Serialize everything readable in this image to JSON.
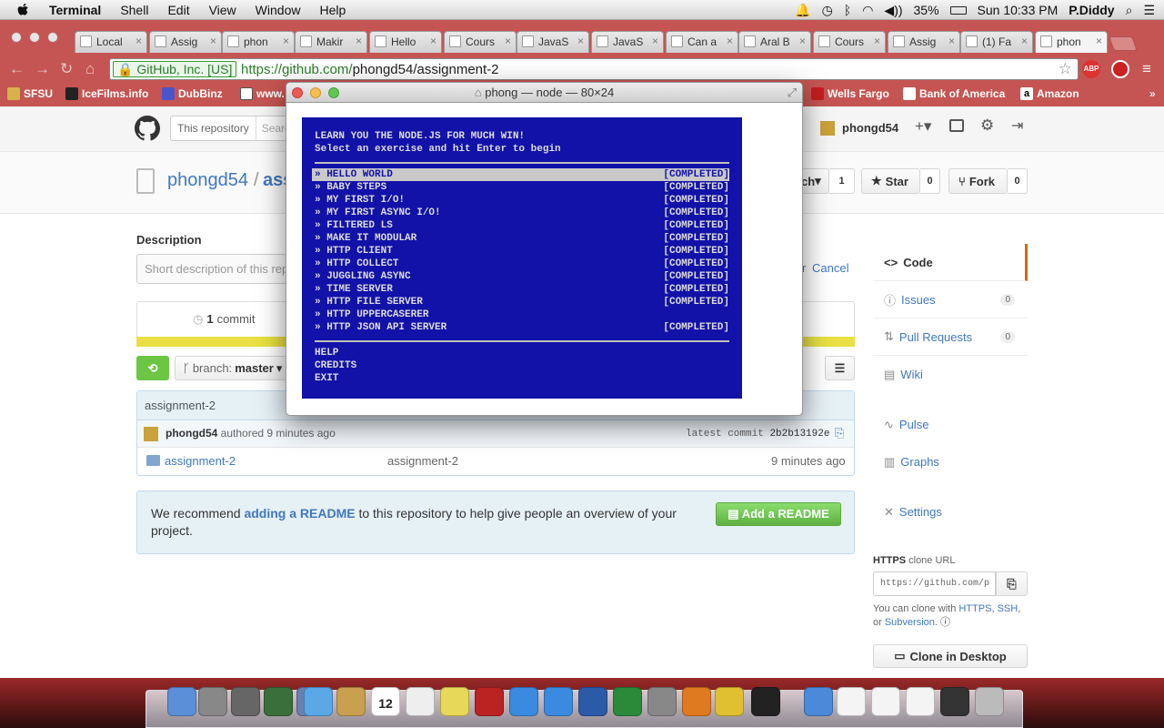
{
  "menubar": {
    "app": "Terminal",
    "items": [
      "Shell",
      "Edit",
      "View",
      "Window",
      "Help"
    ],
    "battery": "35%",
    "clock": "Sun 10:33 PM",
    "user": "P.Diddy"
  },
  "browser": {
    "tabs": [
      "Local",
      "Assig",
      "phon",
      "Makir",
      "Hello",
      "Cours",
      "JavaS",
      "JavaS",
      "Can a",
      "Aral B",
      "Cours",
      "Assig",
      "(1) Fa",
      "phon"
    ],
    "address": {
      "identity": "GitHub, Inc. [US]",
      "url_prefix": "https://github.com/",
      "url_path": "phongd54/assignment-2"
    },
    "bookmarks": [
      "SFSU",
      "IceFilms.info",
      "DubBinz",
      "www.",
      "Wells Fargo",
      "Bank of America",
      "Amazon"
    ],
    "ext": {
      "abp": "ABP"
    }
  },
  "github": {
    "search_scope": "This repository",
    "search_placeholder": "Search",
    "user": "phongd54",
    "owner": "phongd54",
    "repo_partial": "ass",
    "watch_label": "ch",
    "watch_count": "1",
    "star_label": "Star",
    "star_count": "0",
    "fork_label": "Fork",
    "fork_count": "0",
    "description_heading": "Description",
    "description_placeholder": "Short description of this rep",
    "or_text": "r",
    "cancel": "Cancel",
    "commits_count": "1",
    "commits_label": "commit",
    "branch_label": "branch:",
    "branch_name": "master",
    "file_header": "assignment-2",
    "author": "phongd54",
    "authored": "authored 9 minutes ago",
    "latest_commit_label": "latest commit",
    "commit_sha": "2b2b13192e",
    "files": [
      {
        "name": "assignment-2",
        "message": "assignment-2",
        "age": "9 minutes ago"
      }
    ],
    "readme_pre": "We recommend ",
    "readme_link": "adding a README",
    "readme_post": " to this repository to help give people an overview of your project.",
    "add_readme": "Add a README",
    "sidebar": {
      "code": "Code",
      "issues": "Issues",
      "issues_count": "0",
      "pulls": "Pull Requests",
      "pulls_count": "0",
      "wiki": "Wiki",
      "pulse": "Pulse",
      "graphs": "Graphs",
      "settings": "Settings"
    },
    "clone": {
      "heading": "HTTPS",
      "heading_rest": "clone URL",
      "url": "https://github.com/p",
      "note_pre": "You can clone with ",
      "https": "HTTPS",
      "ssh": "SSH",
      "or": ", or ",
      "subversion": "Subversion",
      "desktop": "Clone in Desktop"
    }
  },
  "terminal": {
    "title": "phong — node — 80×24",
    "header1": "LEARN YOU THE NODE.JS FOR MUCH WIN!",
    "header2": "Select an exercise and hit Enter to begin",
    "exercises": [
      {
        "name": "» HELLO WORLD",
        "status": "[COMPLETED]"
      },
      {
        "name": "» BABY STEPS",
        "status": "[COMPLETED]"
      },
      {
        "name": "» MY FIRST I/O!",
        "status": "[COMPLETED]"
      },
      {
        "name": "» MY FIRST ASYNC I/O!",
        "status": "[COMPLETED]"
      },
      {
        "name": "» FILTERED LS",
        "status": "[COMPLETED]"
      },
      {
        "name": "» MAKE IT MODULAR",
        "status": "[COMPLETED]"
      },
      {
        "name": "» HTTP CLIENT",
        "status": "[COMPLETED]"
      },
      {
        "name": "» HTTP COLLECT",
        "status": "[COMPLETED]"
      },
      {
        "name": "» JUGGLING ASYNC",
        "status": "[COMPLETED]"
      },
      {
        "name": "» TIME SERVER",
        "status": "[COMPLETED]"
      },
      {
        "name": "» HTTP FILE SERVER",
        "status": "[COMPLETED]"
      },
      {
        "name": "» HTTP UPPERCASERER",
        "status": ""
      },
      {
        "name": "» HTTP JSON API SERVER",
        "status": "[COMPLETED]"
      }
    ],
    "footer": [
      "HELP",
      "CREDITS",
      "EXIT"
    ]
  },
  "dock": {
    "calendar_day": "12"
  },
  "colors": {
    "accent": "#4078c0",
    "terminal_bg": "#1212a8",
    "browser_frame": "#c55552",
    "green": "#6cc644"
  }
}
